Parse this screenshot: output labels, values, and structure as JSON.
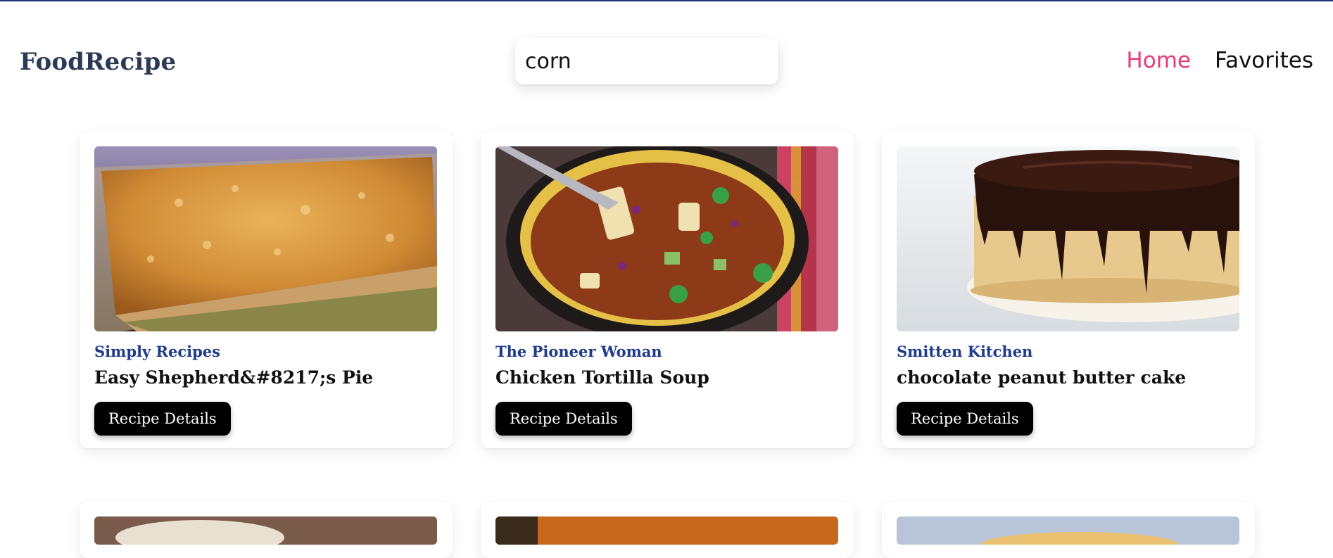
{
  "header": {
    "logo": "FoodRecipe",
    "search": {
      "value": "corn",
      "placeholder": ""
    },
    "nav": [
      {
        "label": "Home",
        "active": true
      },
      {
        "label": "Favorites",
        "active": false
      }
    ]
  },
  "colors": {
    "accent": "#e73b7a",
    "publisher": "#1e3a8a",
    "button": "#000000"
  },
  "recipes": [
    {
      "publisher": "Simply Recipes",
      "title": "Easy Shepherd&#8217;s Pie",
      "button": "Recipe Details"
    },
    {
      "publisher": "The Pioneer Woman",
      "title": "Chicken Tortilla Soup",
      "button": "Recipe Details"
    },
    {
      "publisher": "Smitten Kitchen",
      "title": "chocolate peanut butter cake",
      "button": "Recipe Details"
    }
  ]
}
